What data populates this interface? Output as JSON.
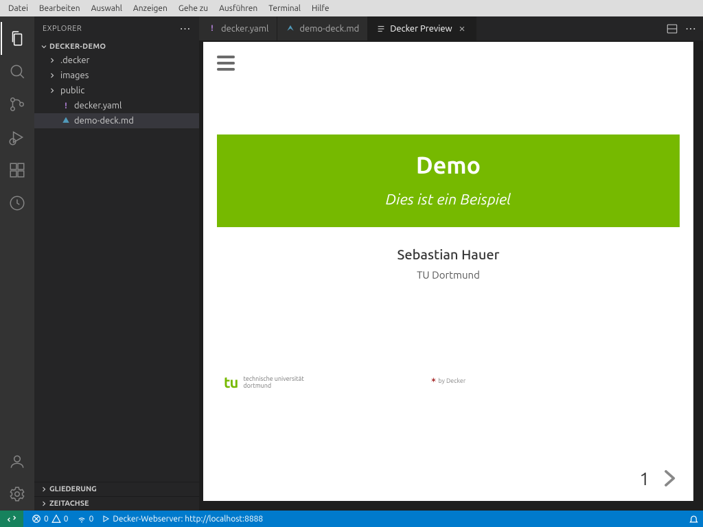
{
  "menubar": [
    "Datei",
    "Bearbeiten",
    "Auswahl",
    "Anzeigen",
    "Gehe zu",
    "Ausführen",
    "Terminal",
    "Hilfe"
  ],
  "explorer": {
    "title": "EXPLORER",
    "root": "DECKER-DEMO",
    "folders": [
      ".decker",
      "images",
      "public"
    ],
    "files": [
      {
        "name": "decker.yaml",
        "type": "yaml"
      },
      {
        "name": "demo-deck.md",
        "type": "md",
        "selected": true
      }
    ],
    "panels": [
      "GLIEDERUNG",
      "ZEITACHSE"
    ]
  },
  "tabs": [
    {
      "label": "decker.yaml",
      "type": "yaml"
    },
    {
      "label": "demo-deck.md",
      "type": "md"
    },
    {
      "label": "Decker Preview",
      "type": "preview",
      "active": true,
      "closable": true
    }
  ],
  "preview": {
    "title": "Demo",
    "subtitle": "Dies ist ein Beispiel",
    "author": "Sebastian Hauer",
    "affiliation": "TU Dortmund",
    "logo_mark": "tu",
    "logo_line1": "technische universität",
    "logo_line2": "dortmund",
    "credit": "by Decker",
    "page": "1"
  },
  "statusbar": {
    "errors": "0",
    "warnings": "0",
    "port": "0",
    "server": "Decker-Webserver: http://localhost:8888"
  }
}
